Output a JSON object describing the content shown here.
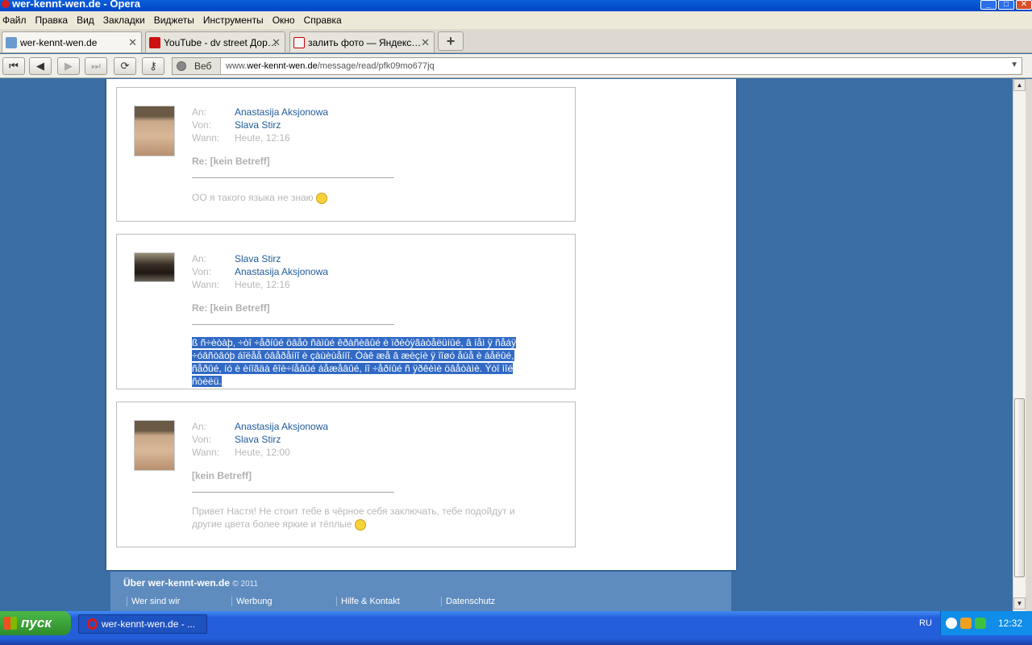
{
  "window": {
    "title": "wer-kennt-wen.de - Opera"
  },
  "menu": [
    "Файл",
    "Правка",
    "Вид",
    "Закладки",
    "Виджеты",
    "Инструменты",
    "Окно",
    "Справка"
  ],
  "tabs": [
    {
      "label": "wer-kennt-wen.de",
      "active": true
    },
    {
      "label": "YouTube - dv street Дор…",
      "active": false
    },
    {
      "label": "залить фото — Яндекс…",
      "active": false
    }
  ],
  "nav": {
    "web_label": "Веб",
    "url_prefix": "www.",
    "url_domain": "wer-kennt-wen.de",
    "url_path": "/message/read/pfk09mo677jq"
  },
  "labels": {
    "to": "An:",
    "from": "Von:",
    "when": "Wann:"
  },
  "messages": [
    {
      "to": "Anastasija Aksjonowa",
      "from": "Slava Stirz",
      "when": "Heute, 12:16",
      "subject": "Re: [kein Betreff]",
      "body": "ОО я такого языка не знаю",
      "emoticon": "sad-face-icon"
    },
    {
      "to": "Slava Stirz",
      "from": "Anastasija Aksjonowa",
      "when": "Heute, 12:16",
      "subject": "Re: [kein Betreff]",
      "body": "ß ñ÷èòàþ, ÷òî ÷åðíûé öâåò ñàìûé êðàñèâûé è ïðèòÿãàòåëüíûé, â íåì ÿ ñåáÿ ÷óâñòâóþ áîëåå óâåðåííî è çàùèùåííî. Òàê æå â æèçíè ÿ ïîøó åùå è áåëûé, ñåðûé, íó è èíîãäà êîè÷íåâûé áåæåâûé, íî ÷åðíûé ñ ÿðêèìè öâåòàìè. Ýòî ìîé ñòèëü."
    },
    {
      "to": "Anastasija Aksjonowa",
      "from": "Slava Stirz",
      "when": "Heute, 12:00",
      "subject": "[kein Betreff]",
      "body": "Привет Настя! Не стоит тебе в чёрное себя заключать, тебе подойдут и другие цвета более яркие и тёплые",
      "emoticon": "smile-face-icon"
    }
  ],
  "footer": {
    "title": "Über wer-kennt-wen.de",
    "copyright": "© 2011",
    "links": [
      "Wer sind wir",
      "Werbung",
      "Hilfe & Kontakt",
      "Datenschutz"
    ]
  },
  "taskbar": {
    "start_label": "пуск",
    "task_label": "wer-kennt-wen.de - ...",
    "lang": "RU",
    "clock": "12:32"
  }
}
